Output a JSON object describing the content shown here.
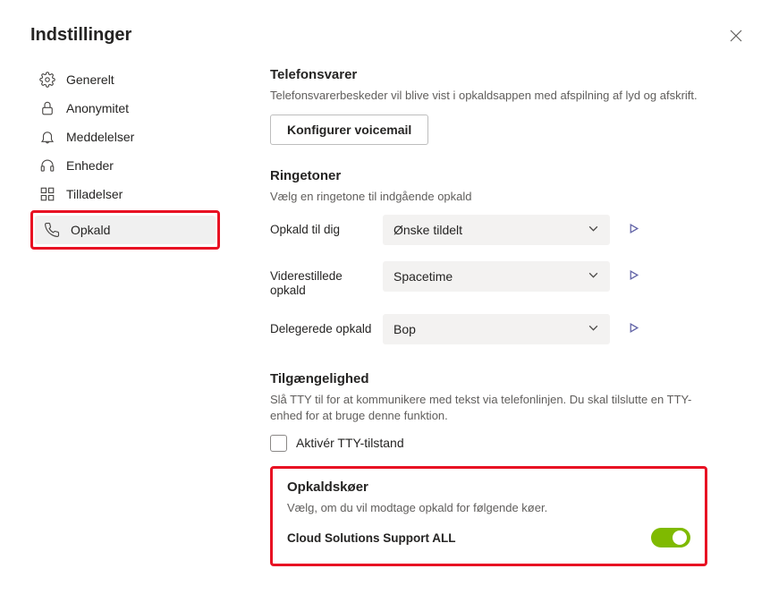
{
  "title": "Indstillinger",
  "sidebar": {
    "items": [
      {
        "label": "Generelt"
      },
      {
        "label": "Anonymitet"
      },
      {
        "label": "Meddelelser"
      },
      {
        "label": "Enheder"
      },
      {
        "label": "Tilladelser"
      },
      {
        "label": "Opkald"
      }
    ]
  },
  "voicemail": {
    "heading": "Telefonsvarer",
    "desc": "Telefonsvarerbeskeder vil blive vist i opkaldsappen med afspilning af lyd og afskrift.",
    "button": "Konfigurer voicemail"
  },
  "ringtones": {
    "heading": "Ringetoner",
    "desc": "Vælg en ringetone til indgående opkald",
    "rows": [
      {
        "label": "Opkald til dig",
        "value": "Ønske tildelt"
      },
      {
        "label": "Viderestillede opkald",
        "value": "Spacetime"
      },
      {
        "label": "Delegerede opkald",
        "value": "Bop"
      }
    ]
  },
  "accessibility": {
    "heading": "Tilgængelighed",
    "desc": "Slå TTY til for at kommunikere med tekst via telefonlinjen. Du skal tilslutte en TTY-enhed for at bruge denne funktion.",
    "checkbox": "Aktivér TTY-tilstand"
  },
  "callqueues": {
    "heading": "Opkaldskøer",
    "desc": "Vælg, om du vil modtage opkald for følgende køer.",
    "items": [
      {
        "name": "Cloud Solutions Support ALL",
        "on": true
      }
    ]
  }
}
